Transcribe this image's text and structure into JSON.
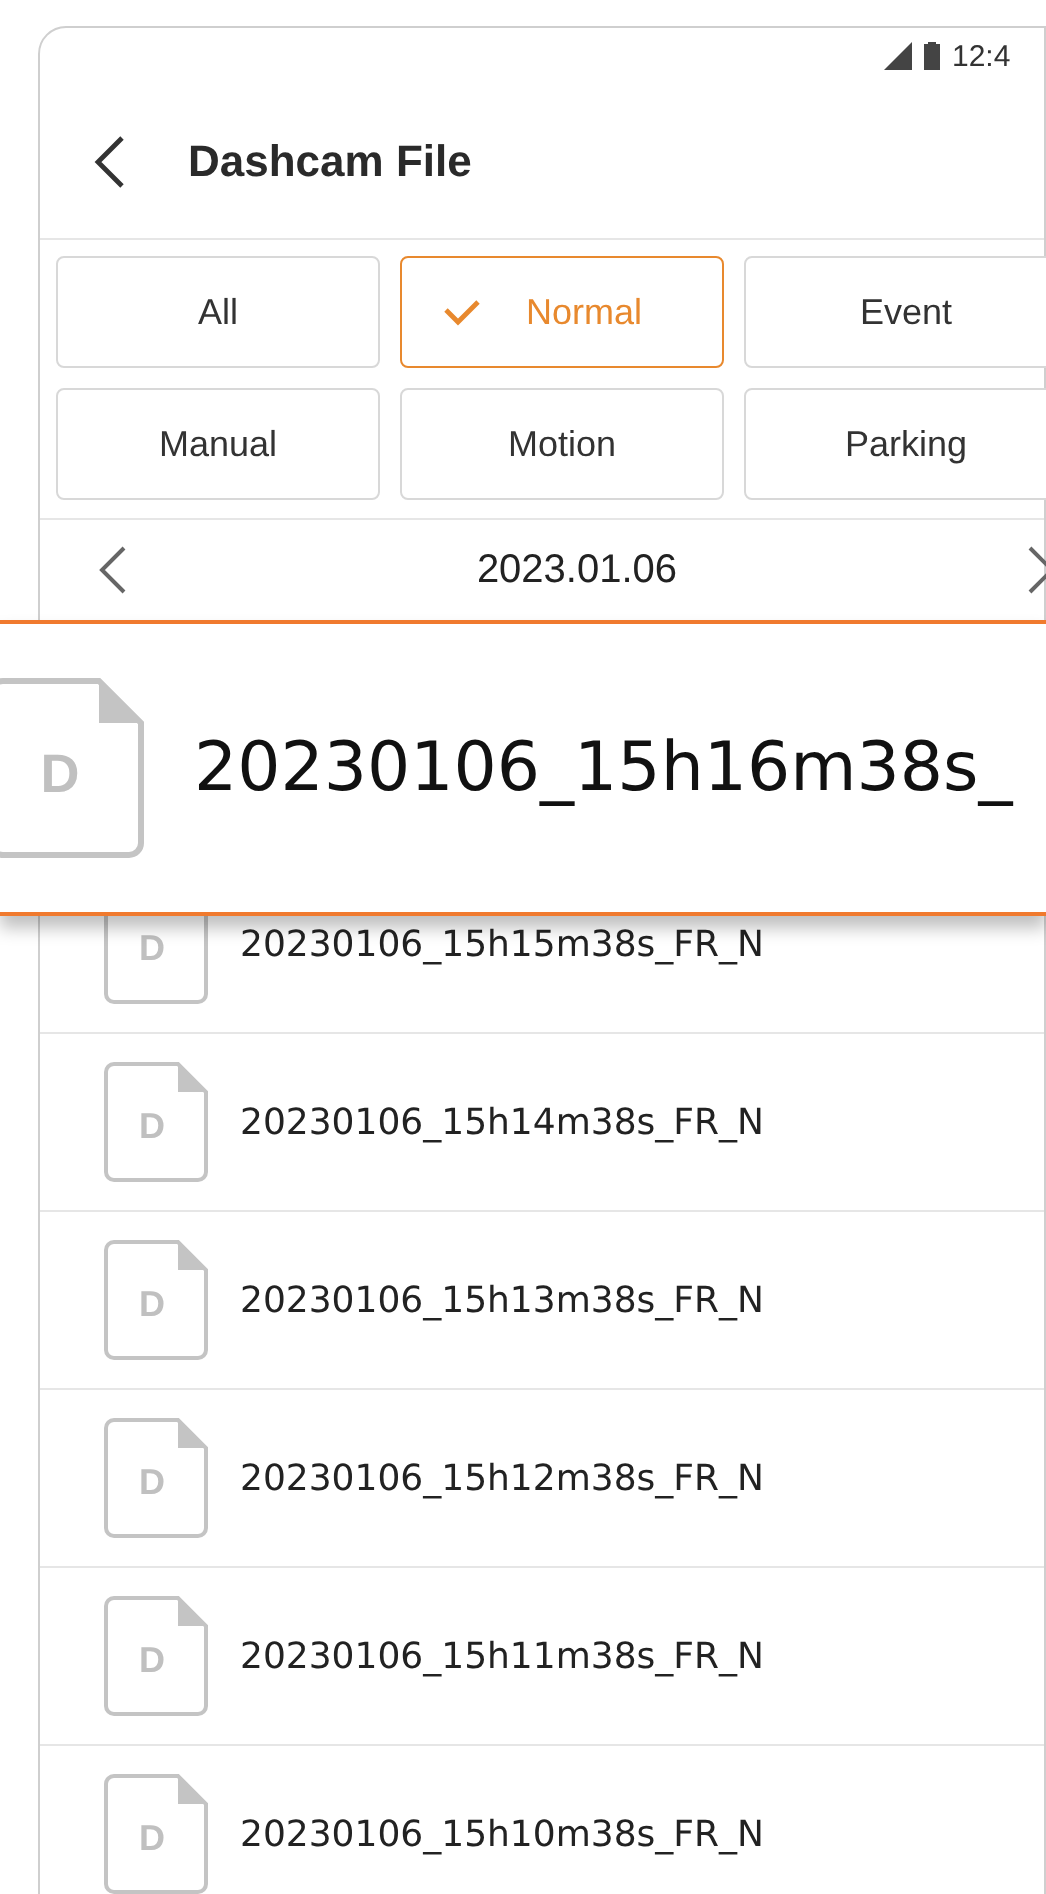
{
  "status_bar": {
    "time": "12:4"
  },
  "header": {
    "title": "Dashcam File"
  },
  "filters": [
    {
      "label": "All",
      "selected": false
    },
    {
      "label": "Normal",
      "selected": true
    },
    {
      "label": "Event",
      "selected": false
    },
    {
      "label": "Manual",
      "selected": false
    },
    {
      "label": "Motion",
      "selected": false
    },
    {
      "label": "Parking",
      "selected": false
    }
  ],
  "date_nav": {
    "date": "2023.01.06"
  },
  "magnified_item": {
    "icon_letter": "D",
    "name": "20230106_15h16m38s_"
  },
  "files": [
    {
      "icon_letter": "D",
      "name": "20230106_15h15m38s_FR_N"
    },
    {
      "icon_letter": "D",
      "name": "20230106_15h14m38s_FR_N"
    },
    {
      "icon_letter": "D",
      "name": "20230106_15h13m38s_FR_N"
    },
    {
      "icon_letter": "D",
      "name": "20230106_15h12m38s_FR_N"
    },
    {
      "icon_letter": "D",
      "name": "20230106_15h11m38s_FR_N"
    },
    {
      "icon_letter": "D",
      "name": "20230106_15h10m38s_FR_N"
    }
  ]
}
